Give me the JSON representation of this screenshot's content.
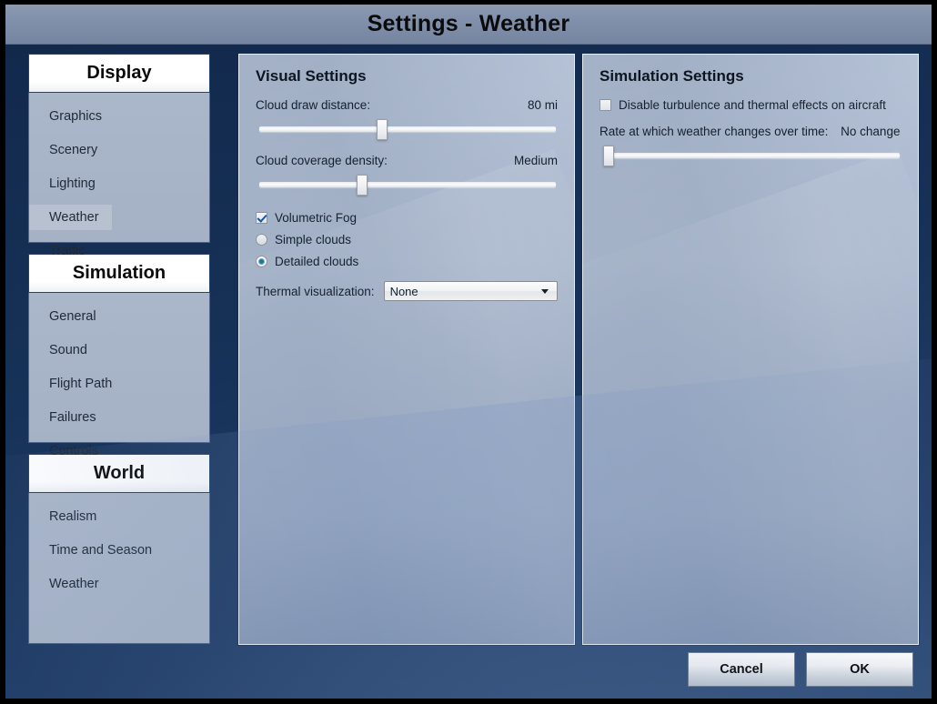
{
  "window": {
    "title": "Settings - Weather"
  },
  "sidebar": {
    "groups": [
      {
        "header": "Display",
        "items": [
          {
            "label": "Graphics",
            "selected": false
          },
          {
            "label": "Scenery",
            "selected": false
          },
          {
            "label": "Lighting",
            "selected": false
          },
          {
            "label": "Weather",
            "selected": true
          },
          {
            "label": "Traffic",
            "selected": false
          }
        ]
      },
      {
        "header": "Simulation",
        "items": [
          {
            "label": "General",
            "selected": false
          },
          {
            "label": "Sound",
            "selected": false
          },
          {
            "label": "Flight Path",
            "selected": false
          },
          {
            "label": "Failures",
            "selected": false
          },
          {
            "label": "Controls",
            "selected": false
          }
        ]
      },
      {
        "header": "World",
        "items": [
          {
            "label": "Realism",
            "selected": false
          },
          {
            "label": "Time and Season",
            "selected": false
          },
          {
            "label": "Weather",
            "selected": false
          }
        ]
      }
    ]
  },
  "visual_panel": {
    "title": "Visual Settings",
    "cloud_draw_distance": {
      "label": "Cloud draw distance:",
      "value": "80 mi",
      "slider_percent": 41
    },
    "cloud_coverage_density": {
      "label": "Cloud coverage density:",
      "value": "Medium",
      "slider_percent": 34
    },
    "volumetric_fog": {
      "label": "Volumetric Fog",
      "checked": true
    },
    "simple_clouds": {
      "label": "Simple clouds",
      "selected": false
    },
    "detailed_clouds": {
      "label": "Detailed clouds",
      "selected": true
    },
    "thermal_visualization": {
      "label": "Thermal visualization:",
      "value": "None",
      "options": [
        "None"
      ]
    }
  },
  "simulation_panel": {
    "title": "Simulation Settings",
    "disable_turbulence": {
      "label": "Disable turbulence and thermal effects on aircraft",
      "checked": false
    },
    "weather_change_rate": {
      "label": "Rate at which weather changes over time:",
      "value": "No change",
      "slider_percent": 0
    }
  },
  "footer": {
    "cancel_label": "Cancel",
    "ok_label": "OK"
  },
  "colors": {
    "titlebar": "#7e8da8",
    "frame_dark": "#173258",
    "panel_bg": "#9aa9c1",
    "sidebar_list": "#a8b4c7",
    "accent_blue": "#1878a8"
  }
}
